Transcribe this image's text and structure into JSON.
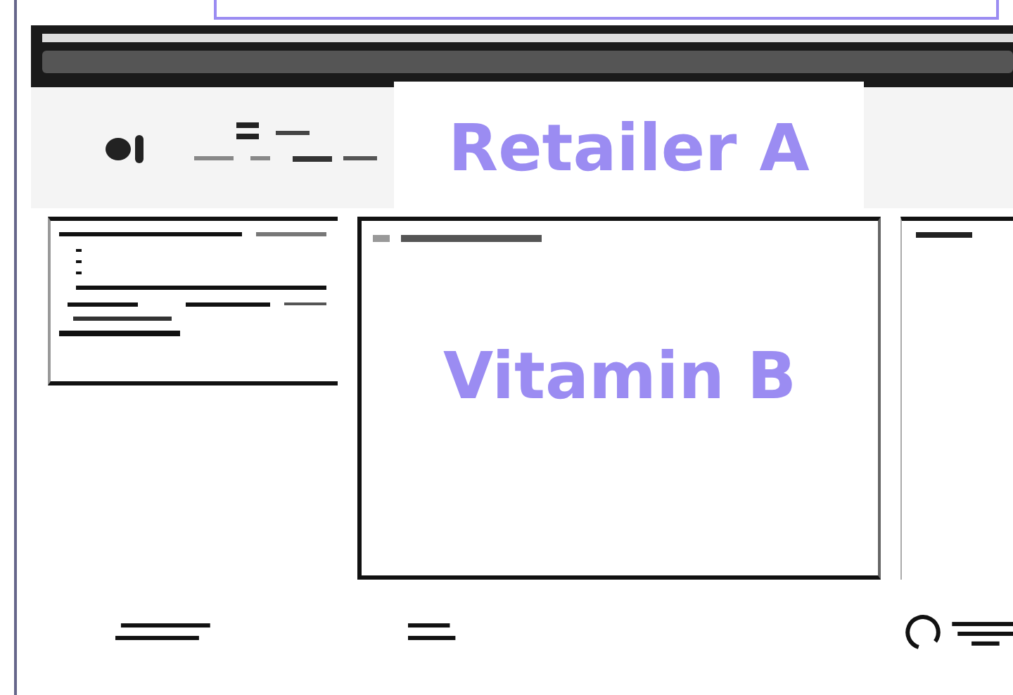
{
  "header": {
    "label": "Retailer A"
  },
  "main_panel": {
    "label": "Vitamin B"
  }
}
